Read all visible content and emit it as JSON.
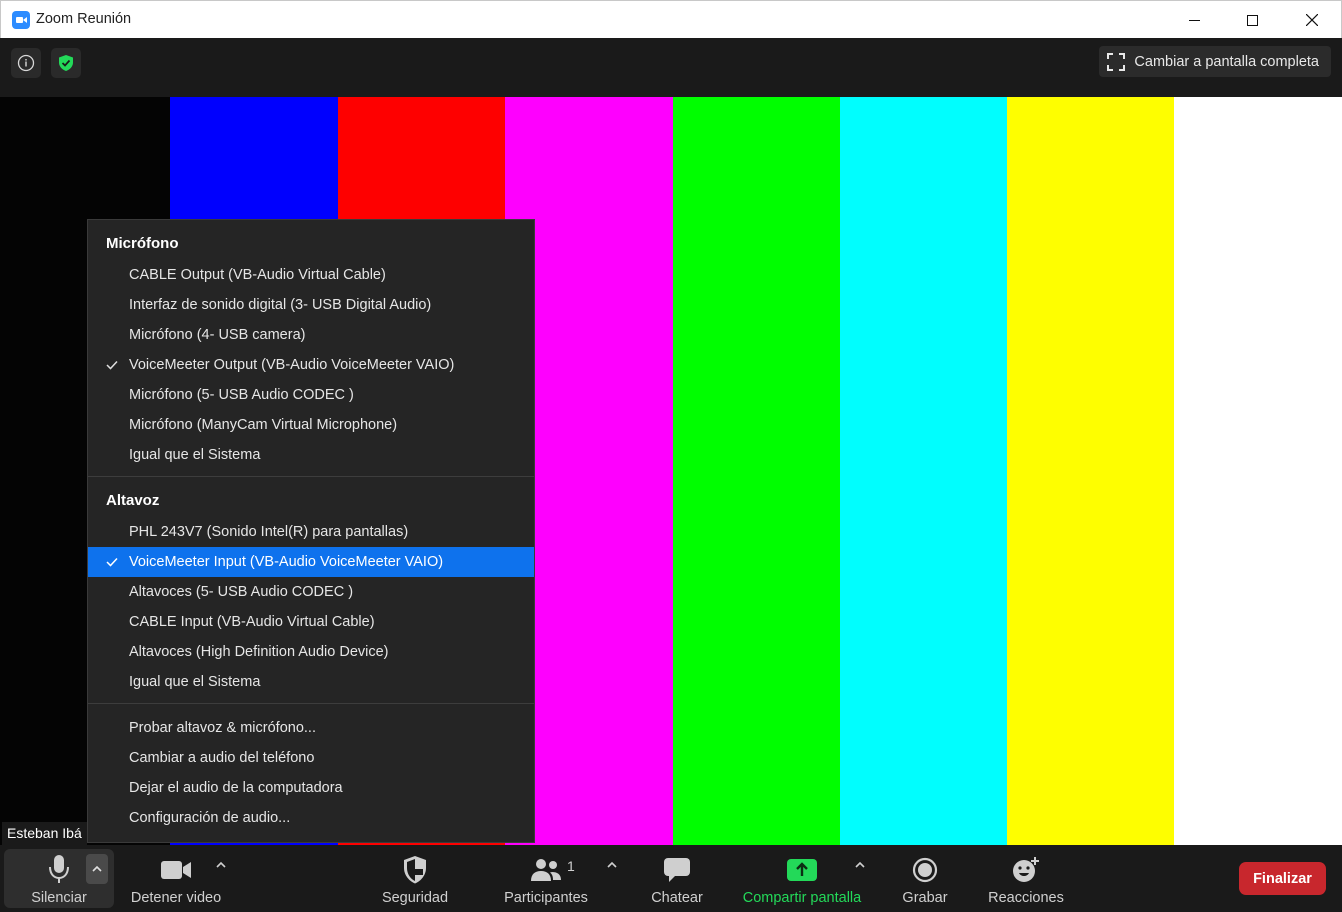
{
  "window": {
    "title": "Zoom Reunión"
  },
  "topbar": {
    "fullscreen_label": "Cambiar a pantalla completa"
  },
  "video": {
    "participant_name": "Esteban Ibá",
    "bar_colors": [
      "#040404",
      "#0000fe",
      "#fe0000",
      "#fe00fe",
      "#00fe00",
      "#00fefe",
      "#fefe00",
      "#ffffff"
    ]
  },
  "audio_menu": {
    "microphone_header": "Micrófono",
    "microphones": [
      {
        "label": "CABLE Output (VB-Audio Virtual Cable)",
        "checked": false
      },
      {
        "label": "Interfaz de sonido digital (3- USB Digital Audio)",
        "checked": false
      },
      {
        "label": "Micrófono (4- USB camera)",
        "checked": false
      },
      {
        "label": "VoiceMeeter Output (VB-Audio VoiceMeeter VAIO)",
        "checked": true
      },
      {
        "label": "Micrófono (5- USB Audio CODEC )",
        "checked": false
      },
      {
        "label": "Micrófono (ManyCam Virtual Microphone)",
        "checked": false
      },
      {
        "label": "Igual que el Sistema",
        "checked": false
      }
    ],
    "speaker_header": "Altavoz",
    "speakers": [
      {
        "label": "PHL 243V7 (Sonido Intel(R) para pantallas)",
        "checked": false
      },
      {
        "label": "VoiceMeeter Input (VB-Audio VoiceMeeter VAIO)",
        "checked": true
      },
      {
        "label": "Altavoces (5- USB Audio CODEC )",
        "checked": false
      },
      {
        "label": "CABLE Input (VB-Audio Virtual Cable)",
        "checked": false
      },
      {
        "label": "Altavoces (High Definition Audio Device)",
        "checked": false
      },
      {
        "label": "Igual que el Sistema",
        "checked": false
      }
    ],
    "actions": [
      "Probar altavoz & micrófono...",
      "Cambiar a audio del teléfono",
      "Dejar el audio de la computadora",
      "Configuración de audio..."
    ]
  },
  "toolbar": {
    "mute_label": "Silenciar",
    "video_label": "Detener video",
    "security_label": "Seguridad",
    "participants_label": "Participantes",
    "participants_count": "1",
    "chat_label": "Chatear",
    "share_label": "Compartir pantalla",
    "record_label": "Grabar",
    "reactions_label": "Reacciones",
    "end_label": "Finalizar"
  },
  "colors": {
    "accent_blue": "#0e72ed",
    "share_green": "#23d959",
    "end_red": "#c8272d"
  }
}
